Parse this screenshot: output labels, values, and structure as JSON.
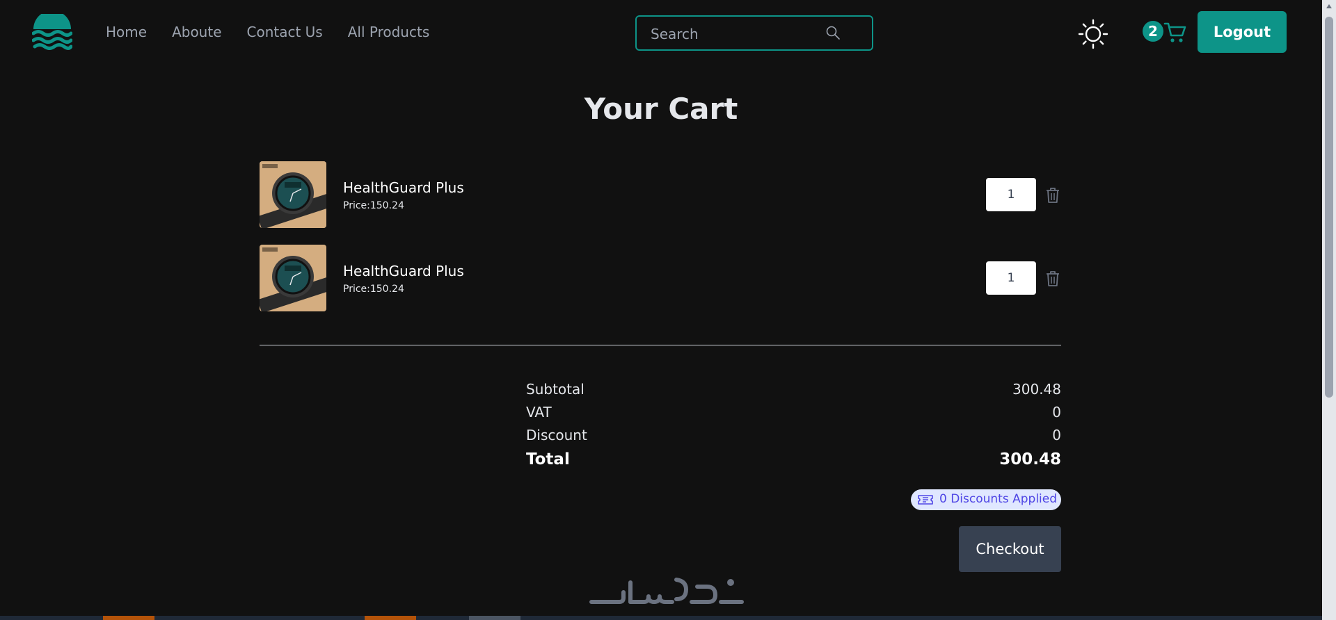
{
  "header": {
    "nav": [
      "Home",
      "Aboute",
      "Contact Us",
      "All Products"
    ],
    "search_placeholder": "Search",
    "cart_count": "2",
    "logout_label": "Logout"
  },
  "title": "Your Cart",
  "items": [
    {
      "name": "HealthGuard Plus",
      "price": "Price:150.24",
      "qty": "1"
    },
    {
      "name": "HealthGuard Plus",
      "price": "Price:150.24",
      "qty": "1"
    }
  ],
  "summary": {
    "subtotal_label": "Subtotal",
    "subtotal_value": "300.48",
    "vat_label": "VAT",
    "vat_value": "0",
    "discount_label": "Discount",
    "discount_value": "0",
    "total_label": "Total",
    "total_value": "300.48"
  },
  "discounts_applied": "0 Discounts Applied",
  "checkout_label": "Checkout",
  "watermark_text": "خمسات",
  "colors": {
    "accent": "#0d9488",
    "background": "#111111",
    "checkout": "#374151",
    "badge_bg": "#e0e7ff",
    "badge_text": "#4f46e5"
  },
  "icons": [
    "waves-logo-icon",
    "search-icon",
    "sun-icon",
    "cart-icon",
    "trash-icon",
    "ticket-icon"
  ]
}
